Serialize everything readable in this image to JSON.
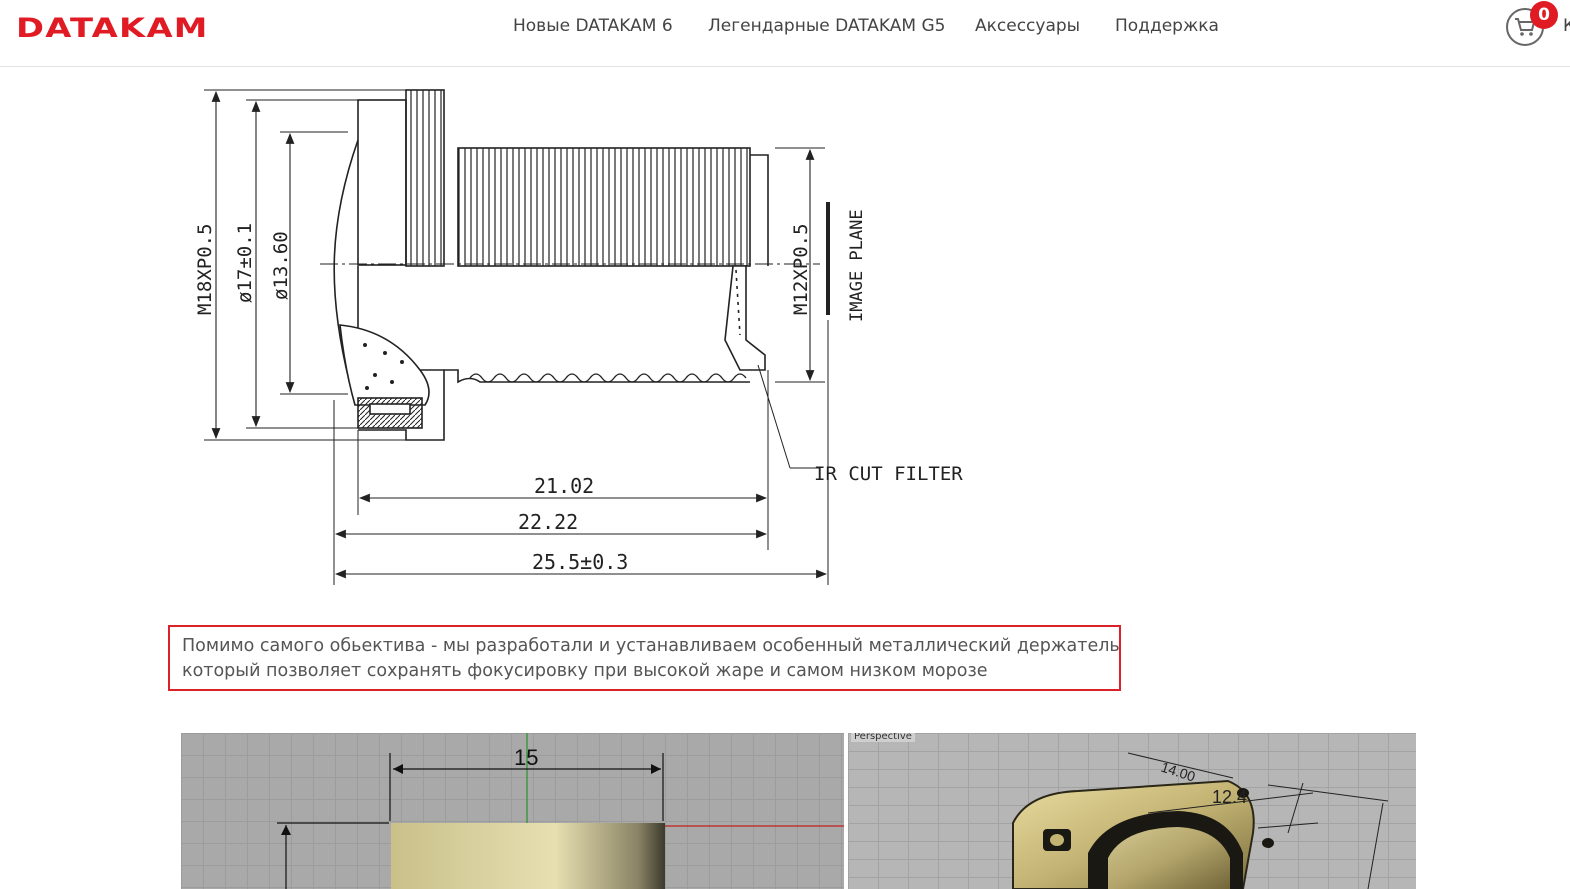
{
  "header": {
    "logo": "DATAKAM",
    "nav": [
      "Новые DATAKAM 6",
      "Легендарные DATAKAM G5",
      "Аксессуары",
      "Поддержка"
    ],
    "cart_count": "0",
    "cart_label": "К"
  },
  "drawing": {
    "dims": {
      "m18": "M18XP0.5",
      "d17": "ø17±0.1",
      "d13": "ø13.60",
      "m12": "M12XP0.5",
      "image_plane": "IMAGE PLANE",
      "ir_cut": "IR CUT FILTER",
      "l1": "21.02",
      "l2": "22.22",
      "l3": "25.5±0.3"
    }
  },
  "note": {
    "line1": "Помимо самого обьектива - мы разработали и устанавливаем особенный металлический держатель",
    "line2": "который позволяет сохранять фокусировку при высокой жаре и самом низком морозе"
  },
  "cad_left": {
    "dim_top": "15"
  },
  "cad_right": {
    "viewport_label": "Perspective",
    "dim_a": "14.00",
    "dim_b": "12.4"
  }
}
